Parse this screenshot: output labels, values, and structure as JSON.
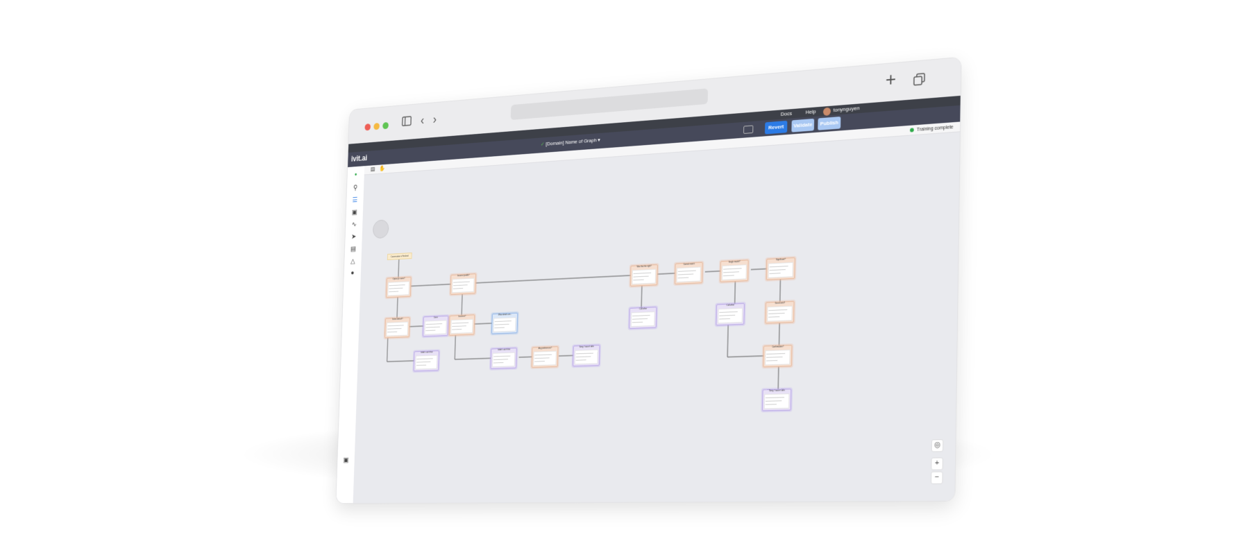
{
  "browser": {
    "back_icon": "chevron-left-icon",
    "forward_icon": "chevron-right-icon",
    "new_tab_icon": "plus-icon",
    "tabs_icon": "tabs-overview-icon"
  },
  "topbar": {
    "docs": "Docs",
    "help": "Help",
    "username": "tonynguyen"
  },
  "toolbar": {
    "logo": "ivit.ai",
    "graph_name": "[Domain] Name of Graph",
    "revert": "Revert",
    "validate": "Validate",
    "publish": "Publish"
  },
  "canvas": {
    "status": "Training complete",
    "start_node": "Conversation is Finished"
  },
  "colors": {
    "primary": "#2c7be5",
    "app_header": "#3d4048",
    "toolbar": "#46495a",
    "node_orange": "#f6dfd0",
    "node_purple": "#e8e1f6",
    "node_blue": "#dce8f8",
    "status_green": "#2eaa4a"
  },
  "zoom": {
    "zoom_in": "+",
    "zoom_out": "−"
  }
}
